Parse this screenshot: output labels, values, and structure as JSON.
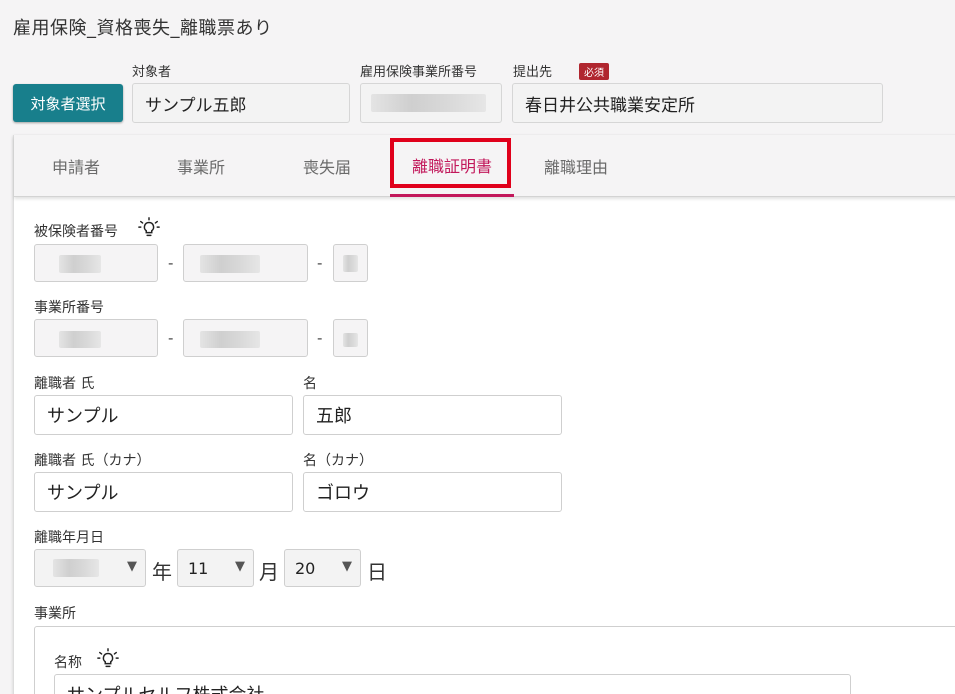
{
  "page": {
    "title": "雇用保険_資格喪失_離職票あり"
  },
  "header": {
    "select_button": "対象者選択",
    "target_label": "対象者",
    "target_value": "サンプル五郎",
    "office_no_label": "雇用保険事業所番号",
    "submit_label": "提出先",
    "required_badge": "必須",
    "submit_value": "春日井公共職業安定所"
  },
  "tabs": [
    {
      "label": "申請者",
      "active": false
    },
    {
      "label": "事業所",
      "active": false
    },
    {
      "label": "喪失届",
      "active": false
    },
    {
      "label": "離職証明書",
      "active": true
    },
    {
      "label": "離職理由",
      "active": false
    }
  ],
  "form": {
    "insured_no_label": "被保険者番号",
    "office_no_label": "事業所番号",
    "separator": "-",
    "last_name_label": "離職者 氏",
    "last_name_value": "サンプル",
    "first_name_label": "名",
    "first_name_value": "五郎",
    "last_kana_label": "離職者 氏（カナ）",
    "last_kana_value": "サンプル",
    "first_kana_label": "名（カナ）",
    "first_kana_value": "ゴロウ",
    "date_label": "離職年月日",
    "year_unit": "年",
    "month_value": "11",
    "month_unit": "月",
    "day_value": "20",
    "day_unit": "日",
    "office_section_label": "事業所",
    "office_name_label": "名称",
    "office_name_value": "サンプルセルフ株式会社"
  },
  "icons": {
    "hint": "lightbulb-icon",
    "dropdown": "triangle-down-icon"
  },
  "colors": {
    "primary": "#187f8c",
    "active_tab": "#c2185b",
    "highlight": "#e0001b",
    "required": "#b0262f"
  }
}
